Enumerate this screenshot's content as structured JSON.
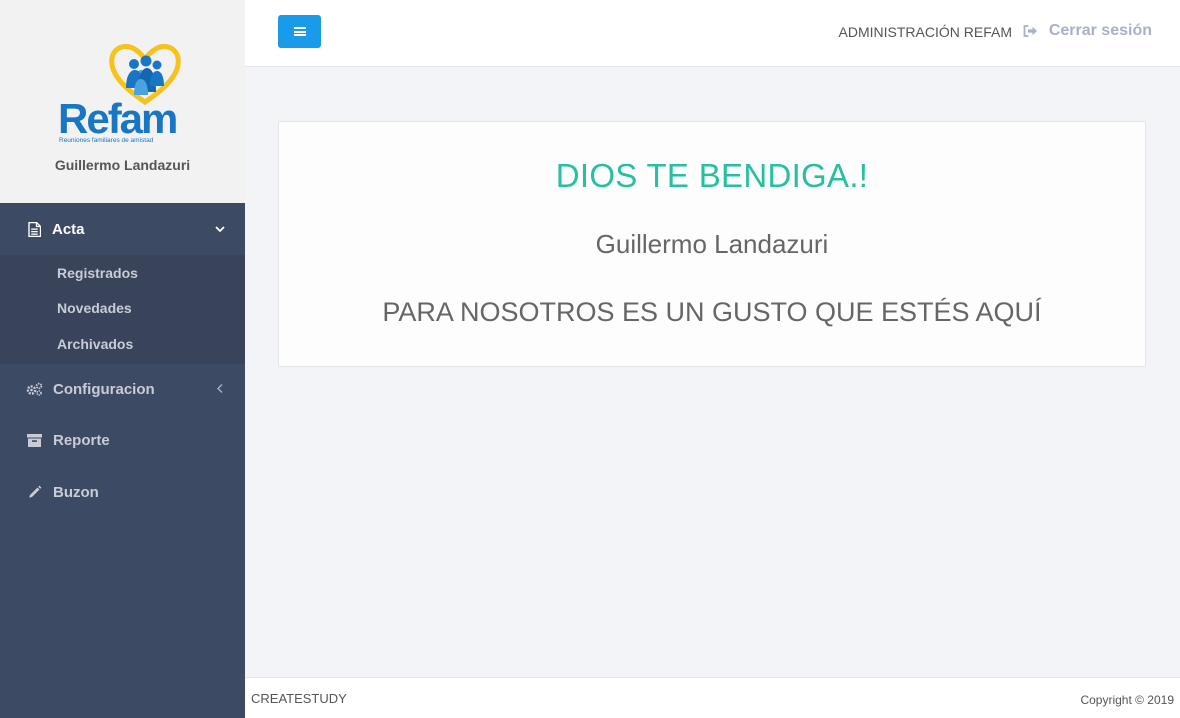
{
  "brand": {
    "logo_text": "Refam",
    "logo_tagline": "Reuniones familiares de amistad"
  },
  "profile": {
    "name": "Guillermo Landazuri"
  },
  "sidebar": {
    "items": [
      {
        "label": "Acta",
        "icon": "file-text-icon",
        "expanded": true,
        "children": [
          {
            "label": "Registrados"
          },
          {
            "label": "Novedades"
          },
          {
            "label": "Archivados"
          }
        ]
      },
      {
        "label": "Configuracion",
        "icon": "cogs-icon",
        "expanded": false
      },
      {
        "label": "Reporte",
        "icon": "archive-icon"
      },
      {
        "label": "Buzon",
        "icon": "pencil-icon"
      }
    ]
  },
  "header": {
    "menu_toggle_icon": "bars-icon",
    "admin_label": "ADMINISTRACIÓN REFAM",
    "logout_label": "Cerrar sesión",
    "logout_icon": "sign-out-icon"
  },
  "welcome": {
    "title": "DIOS TE BENDIGA.!",
    "name": "Guillermo Landazuri",
    "message": "PARA NOSOTROS ES UN GUSTO QUE ESTÉS AQUÍ"
  },
  "footer": {
    "left": "CREATESTUDY",
    "right": "Copyright © 2019"
  },
  "colors": {
    "sidebar_bg": "#3d4a63",
    "primary": "#1a9bea",
    "title_accent": "#27bfa0",
    "brand_blue": "#1976c5",
    "brand_gold": "#f6c21c"
  }
}
